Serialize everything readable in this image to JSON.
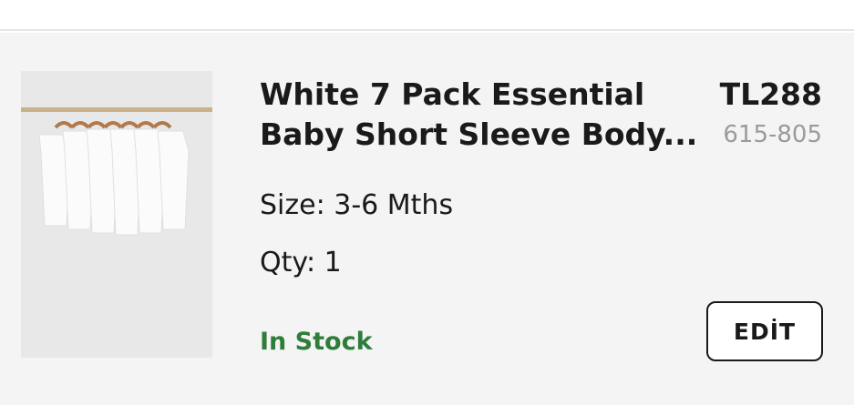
{
  "item": {
    "title_line1": "White 7 Pack Essential",
    "title_line2": "Baby Short Sleeve Body...",
    "price": "TL288",
    "sku": "615-805",
    "size_label": "Size:",
    "size_value": "3-6 Mths",
    "qty_label": "Qty:",
    "qty_value": "1",
    "stock_status": "In Stock",
    "edit_label": "EDİT",
    "image_alt": "white bodysuits on hangers"
  },
  "colors": {
    "stock_green": "#2f7d3b",
    "sku_grey": "#9a9a9a",
    "card_bg": "#f4f4f4"
  }
}
